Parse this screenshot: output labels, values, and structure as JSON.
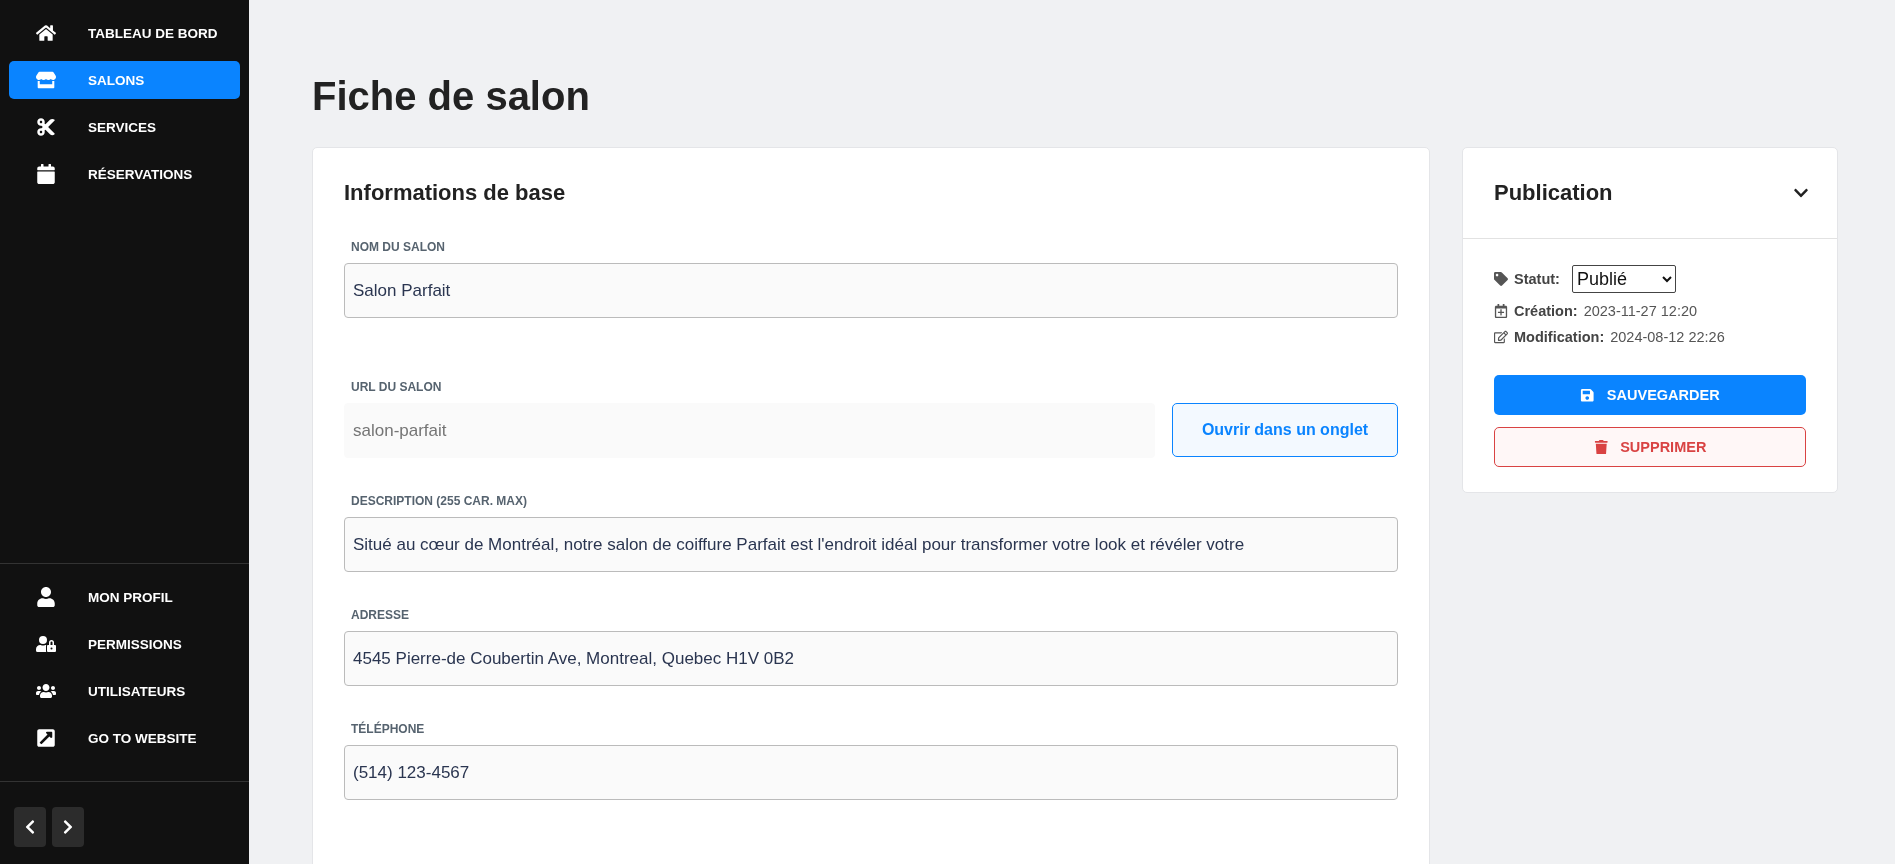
{
  "sidebar": {
    "main_items": [
      {
        "label": "TABLEAU DE BORD",
        "selected": false
      },
      {
        "label": "SALONS",
        "selected": true
      },
      {
        "label": "SERVICES",
        "selected": false
      },
      {
        "label": "RÉSERVATIONS",
        "selected": false
      }
    ],
    "bottom_items": [
      {
        "label": "MON PROFIL",
        "selected": false
      },
      {
        "label": "PERMISSIONS",
        "selected": false
      },
      {
        "label": "UTILISATEURS",
        "selected": false
      },
      {
        "label": "GO TO WEBSITE",
        "selected": false
      }
    ]
  },
  "page_title": "Fiche de salon",
  "form": {
    "title": "Informations de base",
    "fields": [
      {
        "label": "NOM DU SALON",
        "value": "Salon Parfait",
        "disabled": false
      },
      {
        "label": "URL DU SALON",
        "placeholder": "salon-parfait",
        "disabled": true,
        "button": "Ouvrir dans un onglet"
      },
      {
        "label": "DESCRIPTION (255 CAR. MAX)",
        "value": "Situé au cœur de Montréal, notre salon de coiffure Parfait est l'endroit idéal pour transformer votre look et révéler votre",
        "disabled": false
      },
      {
        "label": "ADRESSE",
        "value": "4545 Pierre-de Coubertin Ave, Montreal, Quebec H1V 0B2",
        "disabled": false
      },
      {
        "label": "TÉLÉPHONE",
        "value": "(514) 123-4567",
        "disabled": false
      }
    ]
  },
  "publication": {
    "title": "Publication",
    "expanded": true,
    "status": {
      "label": "Statut:",
      "value": "Publié"
    },
    "meta": [
      {
        "label": "Création:",
        "value": "2023-11-27 12:20"
      },
      {
        "label": "Modification:",
        "value": "2024-08-12 22:26"
      }
    ],
    "save_button": "SAUVEGARDER",
    "delete_button": "SUPPRIMER"
  }
}
